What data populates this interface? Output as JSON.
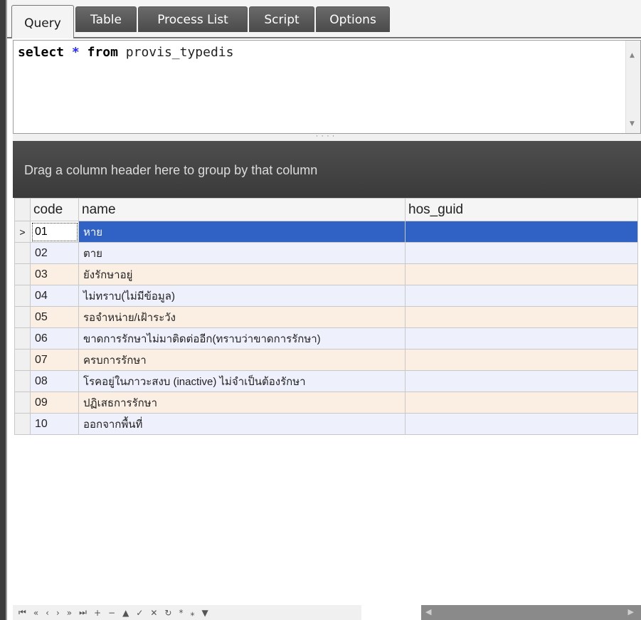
{
  "tabs": [
    {
      "label": "Query",
      "active": true
    },
    {
      "label": "Table",
      "active": false
    },
    {
      "label": "Process List",
      "active": false
    },
    {
      "label": "Script",
      "active": false
    },
    {
      "label": "Options",
      "active": false
    }
  ],
  "editor": {
    "kw_select": "select",
    "star": "*",
    "kw_from": "from",
    "table_name": "provis_typedis"
  },
  "group_panel": {
    "text": "Drag a column header here to group by that column"
  },
  "grid": {
    "columns": [
      "code",
      "name",
      "hos_guid"
    ],
    "rows": [
      {
        "code": "01",
        "name": "หาย",
        "hos_guid": ""
      },
      {
        "code": "02",
        "name": "ตาย",
        "hos_guid": ""
      },
      {
        "code": "03",
        "name": "ยังรักษาอยู่",
        "hos_guid": ""
      },
      {
        "code": "04",
        "name": "ไม่ทราบ(ไม่มีข้อมูล)",
        "hos_guid": ""
      },
      {
        "code": "05",
        "name": "รอจำหน่าย/เฝ้าระวัง",
        "hos_guid": ""
      },
      {
        "code": "06",
        "name": "ขาดการรักษาไม่มาติดต่ออีก(ทราบว่าขาดการรักษา)",
        "hos_guid": ""
      },
      {
        "code": "07",
        "name": "ครบการรักษา",
        "hos_guid": ""
      },
      {
        "code": "08",
        "name": "โรคอยู่ในภาวะสงบ (inactive) ไม่จำเป็นต้องรักษา",
        "hos_guid": ""
      },
      {
        "code": "09",
        "name": "ปฏิเสธการรักษา",
        "hos_guid": ""
      },
      {
        "code": "10",
        "name": "ออกจากพื้นที่",
        "hos_guid": ""
      }
    ],
    "selected_index": 0,
    "row_indicator": ">"
  },
  "navigator": {
    "buttons": [
      {
        "name": "first-record-icon",
        "glyph": "⏮"
      },
      {
        "name": "prev-page-icon",
        "glyph": "«"
      },
      {
        "name": "prev-record-icon",
        "glyph": "‹"
      },
      {
        "name": "next-record-icon",
        "glyph": "›"
      },
      {
        "name": "next-page-icon",
        "glyph": "»"
      },
      {
        "name": "last-record-icon",
        "glyph": "⏭"
      },
      {
        "name": "insert-icon",
        "glyph": "+"
      },
      {
        "name": "delete-icon",
        "glyph": "−"
      },
      {
        "name": "edit-icon",
        "glyph": "▲"
      },
      {
        "name": "post-icon",
        "glyph": "✓"
      },
      {
        "name": "cancel-icon",
        "glyph": "✕"
      },
      {
        "name": "refresh-icon",
        "glyph": "↻"
      },
      {
        "name": "bookmark-icon",
        "glyph": "*"
      },
      {
        "name": "goto-bookmark-icon",
        "glyph": "⁎"
      },
      {
        "name": "filter-icon",
        "glyph": "▼"
      }
    ]
  },
  "colors": {
    "selected_row": "#2f62c4",
    "odd_row": "#eef0fb",
    "even_row": "#fbefe3",
    "group_panel": "#444444",
    "tab_inactive": "#5a5a5a"
  }
}
